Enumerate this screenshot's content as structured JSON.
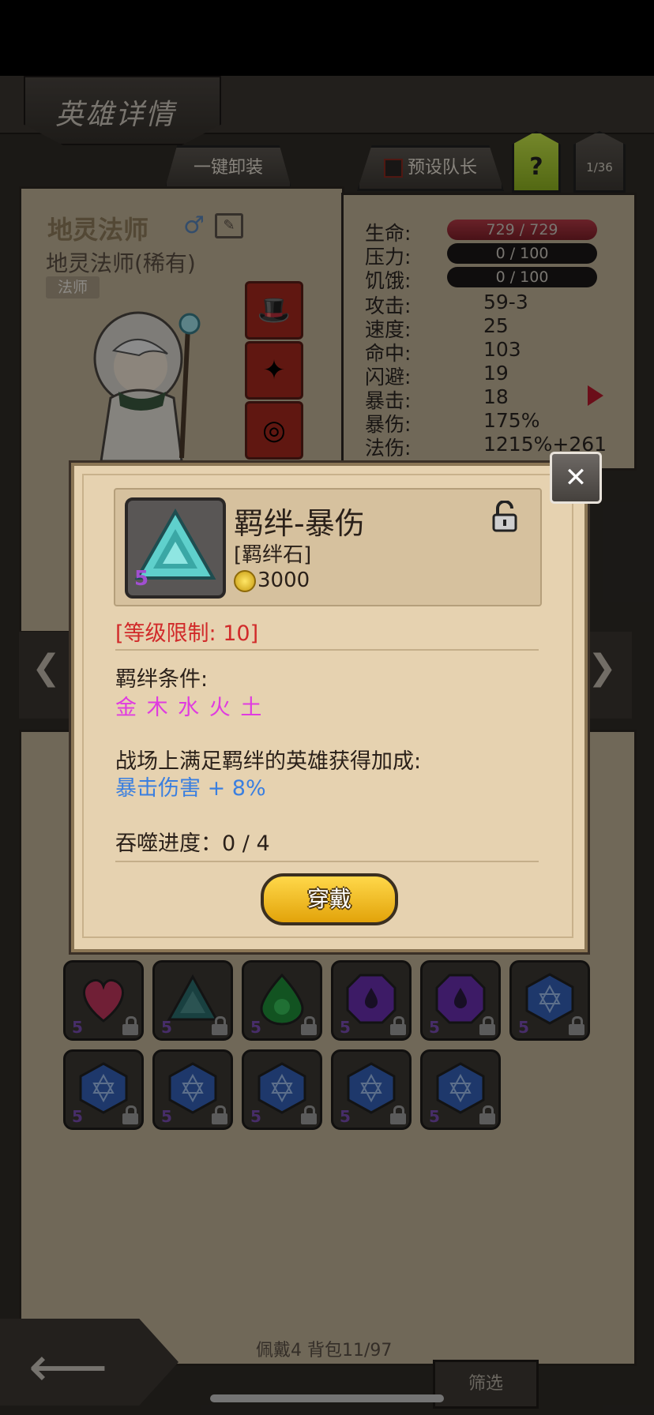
{
  "header": {
    "title": "英雄详情",
    "unequip_all_label": "一键卸装",
    "preset_captain_label": "预设队长",
    "help_label": "?",
    "page_counter": "1/36"
  },
  "hero": {
    "name": "地灵法师",
    "subtitle": "地灵法师(稀有)",
    "class": "法师"
  },
  "stats": {
    "hp_label": "生命:",
    "hp_value": "729 / 729",
    "stress_label": "压力:",
    "stress_value": "0 / 100",
    "hunger_label": "饥饿:",
    "hunger_value": "0 / 100",
    "attack_label": "攻击:",
    "attack_value": "59-3",
    "speed_label": "速度:",
    "speed_value": "25",
    "hit_label": "命中:",
    "hit_value": "103",
    "dodge_label": "闪避:",
    "dodge_value": "19",
    "crit_label": "暴击:",
    "crit_value": "18",
    "crit_dmg_label": "暴伤:",
    "crit_dmg_value": "175%",
    "magic_dmg_label": "法伤:",
    "magic_dmg_value": "1215%+261"
  },
  "popup": {
    "item_name": "羁绊-暴伤",
    "item_type": "[羁绊石]",
    "item_level": "5",
    "price": "3000",
    "level_requirement": "[等级限制: 10]",
    "bond_condition_label": "羁绊条件:",
    "bond_elements": "金 木 水 火 土",
    "bonus_label": "战场上满足羁绊的英雄获得加成:",
    "bonus_value": "暴击伤害 + 8%",
    "devour_progress": "吞噬进度：0 / 4",
    "equip_button_label": "穿戴"
  },
  "inventory": {
    "gems": [
      {
        "shape": "heart",
        "color": "#c2365d",
        "level": "5"
      },
      {
        "shape": "triangle",
        "color": "#2b6f6e",
        "level": "5"
      },
      {
        "shape": "drop",
        "color": "#1f8f3a",
        "level": "5"
      },
      {
        "shape": "octagon",
        "color": "#6a2fb0",
        "level": "5"
      },
      {
        "shape": "octagon",
        "color": "#6a2fb0",
        "level": "5"
      },
      {
        "shape": "hexagon",
        "color": "#3461b8",
        "level": "5"
      },
      {
        "shape": "hexagon",
        "color": "#3461b8",
        "level": "5"
      },
      {
        "shape": "hexagon",
        "color": "#3461b8",
        "level": "5"
      },
      {
        "shape": "hexagon",
        "color": "#3461b8",
        "level": "5"
      },
      {
        "shape": "hexagon",
        "color": "#3461b8",
        "level": "5"
      },
      {
        "shape": "hexagon",
        "color": "#3461b8",
        "level": "5"
      }
    ],
    "equip_count": "佩戴4 背包11/97",
    "filter_label": "筛选"
  }
}
